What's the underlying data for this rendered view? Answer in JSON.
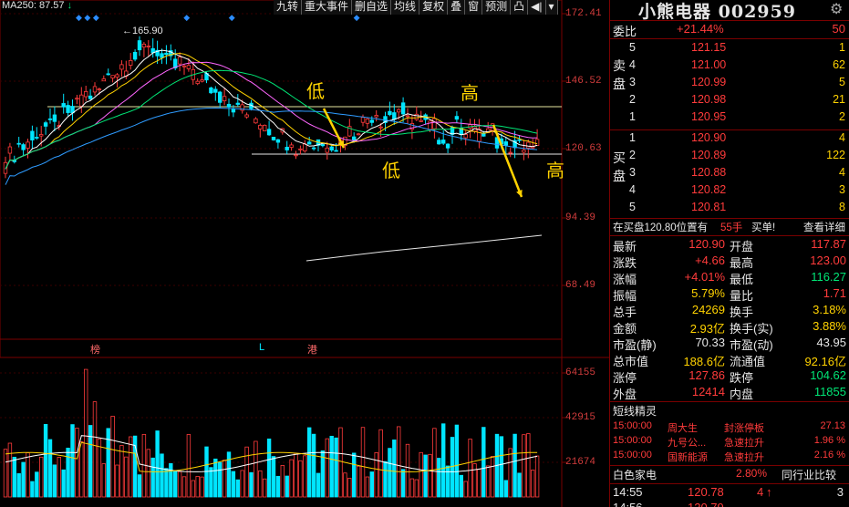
{
  "chart": {
    "ma250_label": "MA250: 87.57",
    "ma250_arrow": "↓",
    "peak_label": "165.90",
    "price_ticks": [
      "172.41",
      "146.52",
      "120.63",
      "94.39",
      "68.49"
    ],
    "volume_ticks": [
      "64155",
      "42915",
      "21674"
    ],
    "markers": {
      "bang": "榜",
      "l": "L",
      "gang": "港"
    },
    "annotations": {
      "low1": "低",
      "high1": "高",
      "low2": "低",
      "high2": "高"
    }
  },
  "toolbar": [
    "九转",
    "重大事件",
    "删自选",
    "均线",
    "复权",
    "叠",
    "窗",
    "预测",
    "凸"
  ],
  "stock": {
    "name": "小熊电器",
    "code": "002959"
  },
  "order_book": {
    "weibi_label": "委比",
    "weibi_pct": "+21.44%",
    "weibi_diff": "50",
    "sell_label": "卖盘",
    "buy_label": "买盘",
    "sell": [
      {
        "lvl": "5",
        "price": "121.15",
        "vol": "1"
      },
      {
        "lvl": "4",
        "price": "121.00",
        "vol": "62"
      },
      {
        "lvl": "3",
        "price": "120.99",
        "vol": "5"
      },
      {
        "lvl": "2",
        "price": "120.98",
        "vol": "21"
      },
      {
        "lvl": "1",
        "price": "120.95",
        "vol": "2"
      }
    ],
    "buy": [
      {
        "lvl": "1",
        "price": "120.90",
        "vol": "4"
      },
      {
        "lvl": "2",
        "price": "120.89",
        "vol": "122"
      },
      {
        "lvl": "3",
        "price": "120.88",
        "vol": "4"
      },
      {
        "lvl": "4",
        "price": "120.82",
        "vol": "3"
      },
      {
        "lvl": "5",
        "price": "120.81",
        "vol": "8"
      }
    ]
  },
  "queue": {
    "text": "在买盘120.80位置有",
    "count": "55手",
    "single": "买单!",
    "detail": "查看详细"
  },
  "stats": [
    {
      "l1": "最新",
      "v1": "120.90",
      "c1": "red",
      "l2": "开盘",
      "v2": "117.87",
      "c2": "red"
    },
    {
      "l1": "涨跌",
      "v1": "+4.66",
      "c1": "red",
      "l2": "最高",
      "v2": "123.00",
      "c2": "red"
    },
    {
      "l1": "涨幅",
      "v1": "+4.01%",
      "c1": "red",
      "l2": "最低",
      "v2": "116.27",
      "c2": "green"
    },
    {
      "l1": "振幅",
      "v1": "5.79%",
      "c1": "yellow",
      "l2": "量比",
      "v2": "1.71",
      "c2": "red"
    },
    {
      "l1": "总手",
      "v1": "24269",
      "c1": "yellow",
      "l2": "换手",
      "v2": "3.18%",
      "c2": "yellow"
    },
    {
      "l1": "金额",
      "v1": "2.93亿",
      "c1": "yellow",
      "l2": "换手(实)",
      "v2": "3.88%",
      "c2": "yellow"
    },
    {
      "l1": "市盈(静)",
      "v1": "70.33",
      "c1": "white",
      "l2": "市盈(动)",
      "v2": "43.95",
      "c2": "white"
    },
    {
      "l1": "总市值",
      "v1": "188.6亿",
      "c1": "yellow",
      "l2": "流通值",
      "v2": "92.16亿",
      "c2": "yellow"
    },
    {
      "l1": "涨停",
      "v1": "127.86",
      "c1": "red",
      "l2": "跌停",
      "v2": "104.62",
      "c2": "green"
    },
    {
      "l1": "外盘",
      "v1": "12414",
      "c1": "red",
      "l2": "内盘",
      "v2": "11855",
      "c2": "green"
    }
  ],
  "news": {
    "title": "短线精灵",
    "items": [
      {
        "time": "15:00:00",
        "name": "周大生",
        "event": "封涨停板",
        "value": "27.13"
      },
      {
        "time": "15:00:00",
        "name": "九号公...",
        "event": "急速拉升",
        "value": "1.96 %"
      },
      {
        "time": "15:00:00",
        "name": "国新能源",
        "event": "急速拉升",
        "value": "2.16 %"
      }
    ]
  },
  "sector": {
    "name": "白色家电",
    "pct": "2.80%",
    "compare": "同行业比较"
  },
  "ticks": [
    {
      "time": "14:55",
      "price": "120.78",
      "vol": "4",
      "arrow": "↑",
      "trail": "3"
    },
    {
      "time": "14:56",
      "price": "120.79",
      "vol": "",
      "arrow": "",
      "trail": ""
    }
  ],
  "colors": {
    "up": "#ff3b3b",
    "down": "#00e5ff",
    "bg": "#000000",
    "annotation": "#ffd200"
  }
}
